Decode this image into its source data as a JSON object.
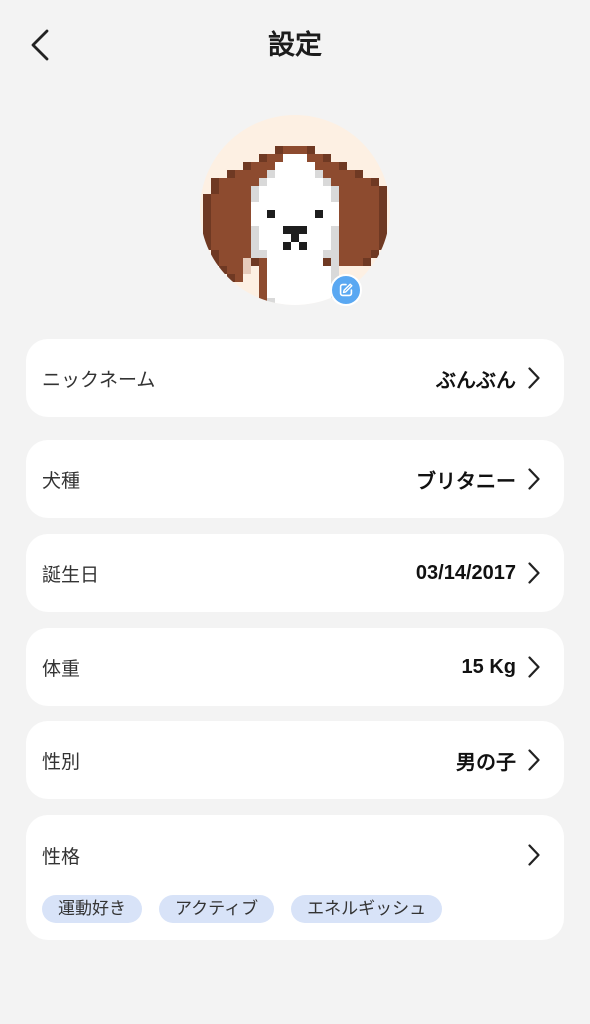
{
  "header": {
    "title": "設定"
  },
  "icons": {
    "back": "chevron-left-icon",
    "row_arrow": "chevron-right-icon",
    "avatar_edit": "edit-icon"
  },
  "settings": [
    {
      "label": "ニックネーム",
      "value": "ぶんぶん"
    },
    {
      "label": "犬種",
      "value": "ブリタニー"
    },
    {
      "label": "誕生日",
      "value": "03/14/2017"
    },
    {
      "label": "体重",
      "value": "15 Kg"
    },
    {
      "label": "性別",
      "value": "男の子"
    }
  ],
  "personality": {
    "label": "性格",
    "tags": [
      "運動好き",
      "アクティブ",
      "エネルギッシュ"
    ]
  },
  "colors": {
    "background": "#f3f3f3",
    "card": "#ffffff",
    "tag_bg": "#d8e3f8",
    "badge": "#5aa8f2",
    "avatar_bg": "#fdf0e3"
  }
}
